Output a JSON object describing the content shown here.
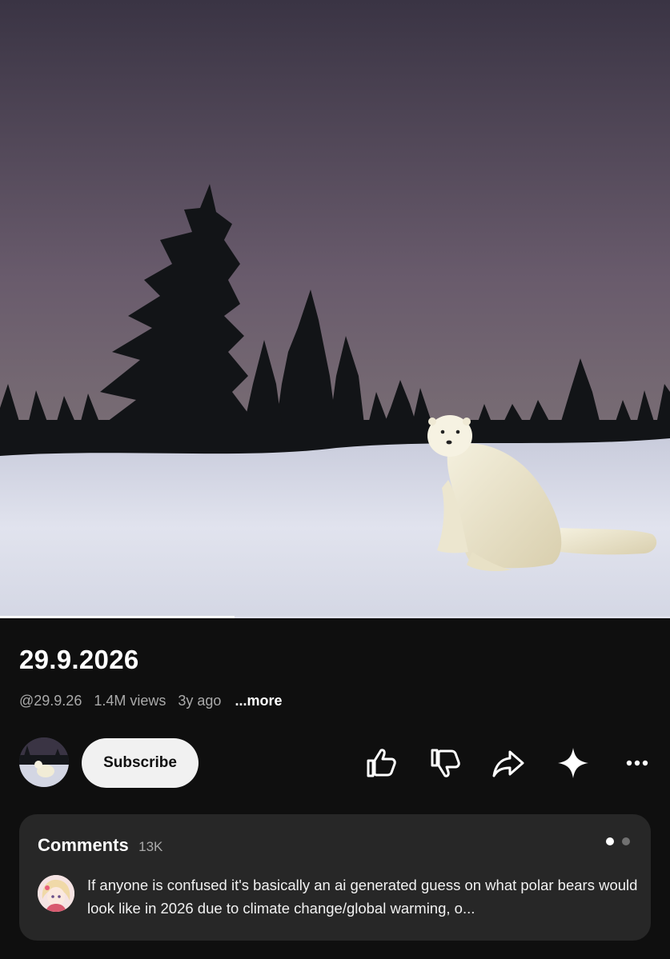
{
  "video": {
    "progress": 0.35,
    "colors": {
      "sky_top": "#3c3545",
      "sky_mid": "#6b5e6f",
      "sky_low": "#7d7478",
      "snow": "#d8dbe8"
    }
  },
  "info": {
    "title": "29.9.2026",
    "channel_handle": "@29.9.26",
    "views": "1.4M views",
    "age": "3y ago",
    "more_label": "...more"
  },
  "actions": {
    "subscribe_label": "Subscribe",
    "icons": [
      "like-icon",
      "dislike-icon",
      "share-icon",
      "ai-sparkle-icon",
      "more-icon"
    ]
  },
  "comments": {
    "title": "Comments",
    "count": "13K",
    "top_comment": "If anyone is confused it's basically an ai generated guess on what polar bears would look like in 2026 due to climate change/global warming, o..."
  },
  "colors": {
    "background": "#0f0f0f",
    "card": "#272727",
    "secondary_text": "#aaaaaa",
    "subscribe_bg": "#f1f1f1"
  }
}
